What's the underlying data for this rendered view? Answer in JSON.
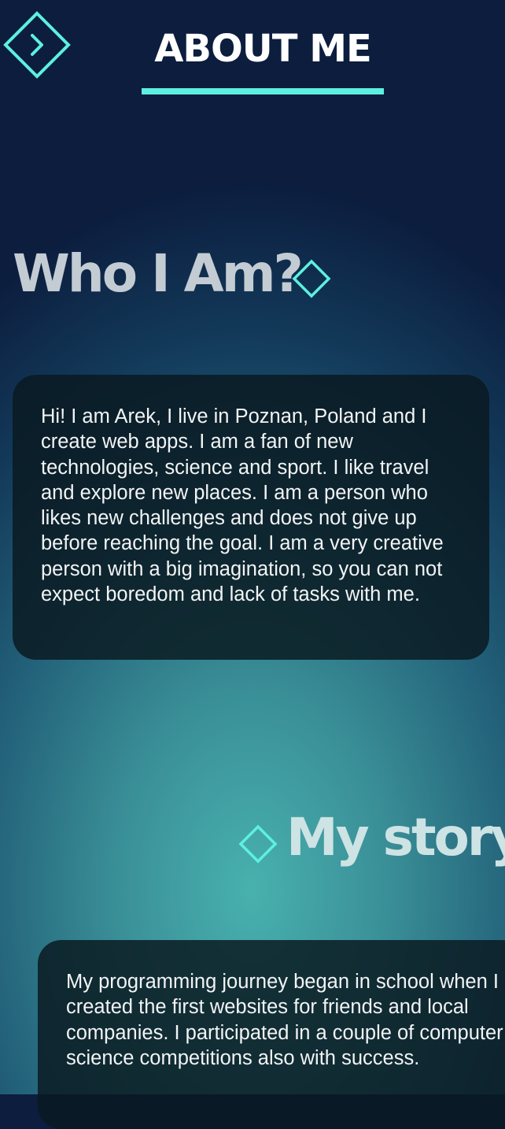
{
  "header": {
    "title": "ABOUT ME",
    "nav_icon": "chevron-right-diamond-icon"
  },
  "colors": {
    "accent": "#5ef0df",
    "card_background": "#0e1e26",
    "heading_light": "#c3ccd3"
  },
  "sections": [
    {
      "heading": "Who I Am?",
      "icon": "diamond-icon",
      "text": "Hi! I am Arek, I live in Poznan, Poland and I create web apps. I am a fan of new technologies, science and sport. I like travel and explore new places. I am a person who likes new challenges and does not give up before reaching the goal. I am a very creative person with a big imagination, so you can not expect boredom and lack of tasks with me."
    },
    {
      "heading": "My story",
      "icon": "diamond-icon",
      "text": "My programming journey began in school when I created the first websites for friends and local companies. I participated in a couple of computer science competitions also with success."
    }
  ]
}
